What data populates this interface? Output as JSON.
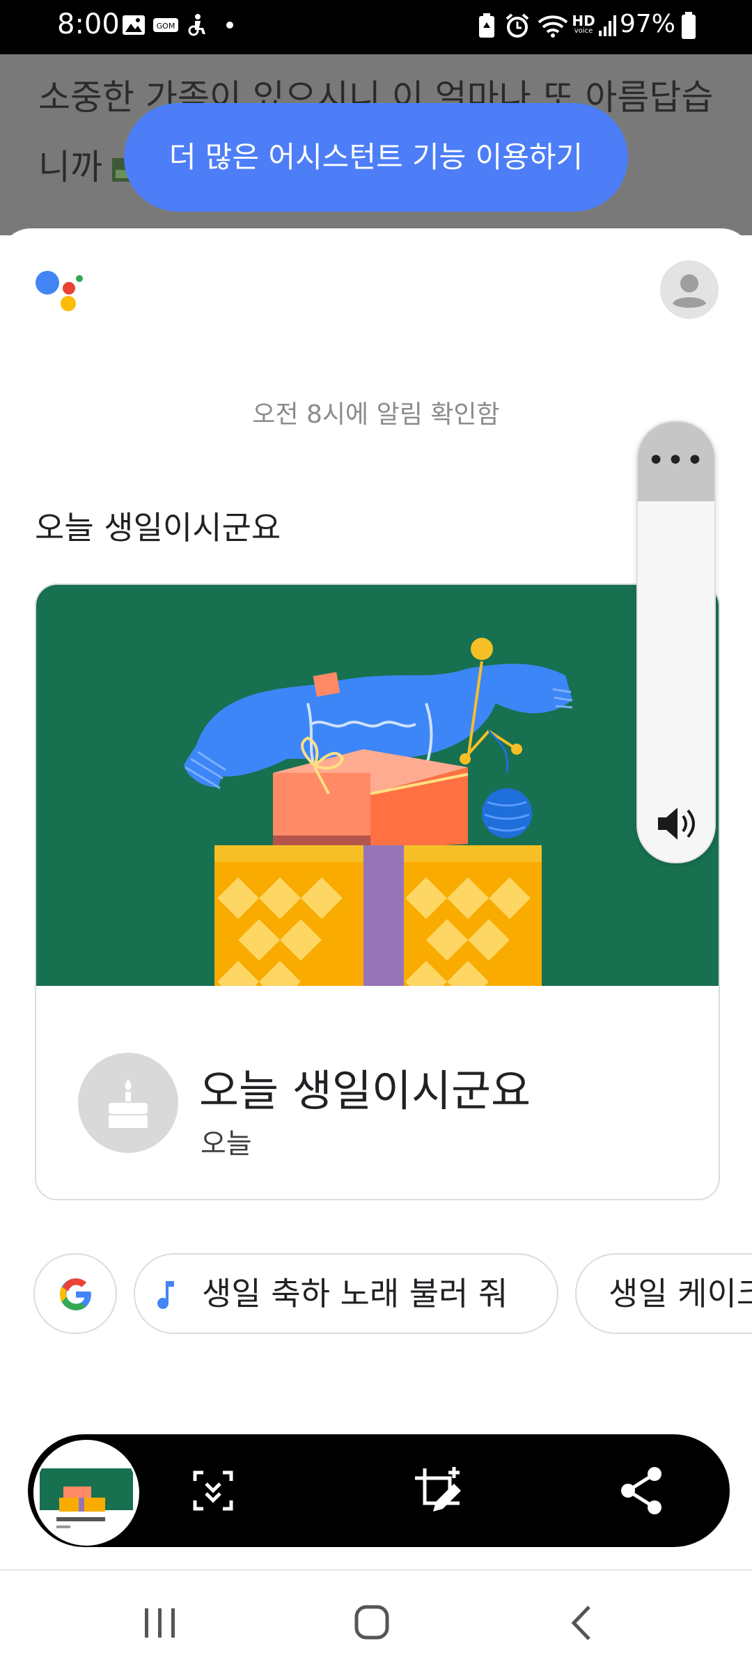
{
  "status_bar": {
    "time": "8:00",
    "battery_percent": "97%",
    "hd_label": "HD",
    "voice_label": "voice"
  },
  "background_page": {
    "line1": "소중한 가족이 있으시니 이 얼마나 또 아름답습",
    "line2": "니까"
  },
  "assistant_prompt": {
    "label": "더 많은 어시스턴트 기능 이용하기"
  },
  "assistant": {
    "notice": "오전 8시에 알림 확인함",
    "heading": "오늘 생일이시군요",
    "card": {
      "title": "오늘 생일이시군요",
      "subtitle": "오늘"
    }
  },
  "volume": {
    "level": 0.18,
    "more_label": "•••"
  },
  "suggestions": [
    {
      "label": "생일 축하 노래 불러 줘",
      "icon": "music-note-icon"
    },
    {
      "label": "생일 케이크",
      "icon": ""
    }
  ],
  "toolbar": {
    "buttons": [
      "scroll-capture-icon",
      "crop-edit-icon",
      "share-icon"
    ]
  },
  "colors": {
    "accent": "#4d7ef7",
    "card_background": "#17704f",
    "google_blue": "#4285f4",
    "google_red": "#ea4335",
    "google_yellow": "#fbbc05",
    "google_green": "#34a853"
  }
}
